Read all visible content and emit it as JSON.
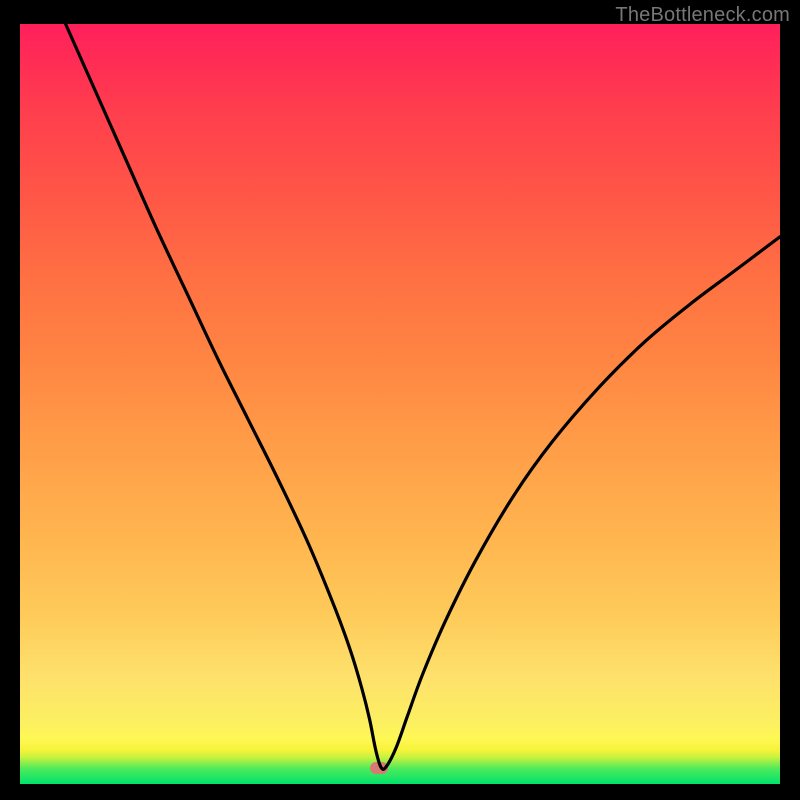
{
  "watermark": "TheBottleneck.com",
  "chart_data": {
    "type": "line",
    "title": "",
    "xlabel": "",
    "ylabel": "",
    "xlim": [
      0,
      100
    ],
    "ylim": [
      0,
      100
    ],
    "grid": false,
    "legend": false,
    "series": [
      {
        "name": "curve",
        "x": [
          6,
          10,
          14,
          18,
          22,
          26,
          30,
          34,
          38,
          41.5,
          43.5,
          45,
          46,
          46.8,
          47.5,
          48.2,
          49.5,
          51,
          53,
          56,
          60,
          65,
          70,
          76,
          82,
          88,
          94,
          100
        ],
        "values": [
          100,
          91,
          82,
          73,
          64.5,
          56,
          48,
          40,
          31.5,
          23,
          17.5,
          12.5,
          8.5,
          4.5,
          2.2,
          2.3,
          4.8,
          9,
          14.5,
          21.5,
          29.5,
          38,
          45,
          52,
          58,
          63,
          67.5,
          72
        ]
      }
    ],
    "marker": {
      "x": 47.2,
      "y": 2.1,
      "color": "#d77a72"
    },
    "gradient_stops": [
      {
        "pos": 0,
        "color": "#00e36b"
      },
      {
        "pos": 4,
        "color": "#c6f23f"
      },
      {
        "pos": 6,
        "color": "#fef854"
      },
      {
        "pos": 30,
        "color": "#ffb64f"
      },
      {
        "pos": 65,
        "color": "#ff6d43"
      },
      {
        "pos": 100,
        "color": "#ff1f5b"
      }
    ]
  }
}
